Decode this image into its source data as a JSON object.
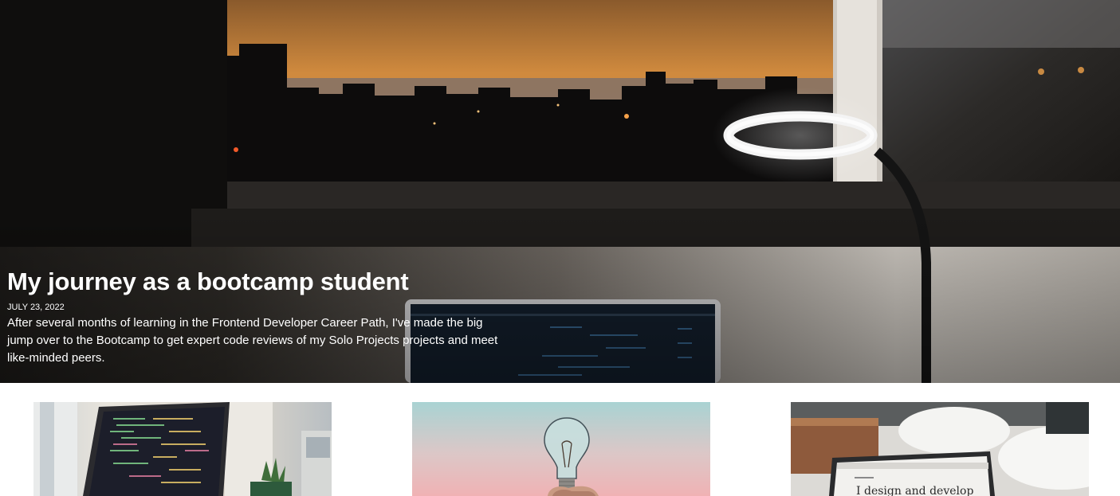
{
  "hero": {
    "title": "My journey as a bootcamp student",
    "date": "JULY 23, 2022",
    "excerpt": "After several months of learning in the Frontend Developer Career Path, I've made the big jump over to the Bootcamp to get expert code reviews of my Solo Projects projects and meet like-minded peers.",
    "image": "desk-with-laptop-and-ring-lamp-at-sunset-photo"
  },
  "cards": [
    {
      "image": "laptop-with-code-and-cactus-photo"
    },
    {
      "image": "hand-holding-light-bulb-photo"
    },
    {
      "image": "laptop-on-white-table-photo",
      "screen_text": "I design and develop"
    }
  ],
  "colors": {
    "sunset_orange": "#d98a3a",
    "sky_teal": "#a9d3d3",
    "sky_pink": "#f0b2b4",
    "text_white": "#ffffff"
  }
}
